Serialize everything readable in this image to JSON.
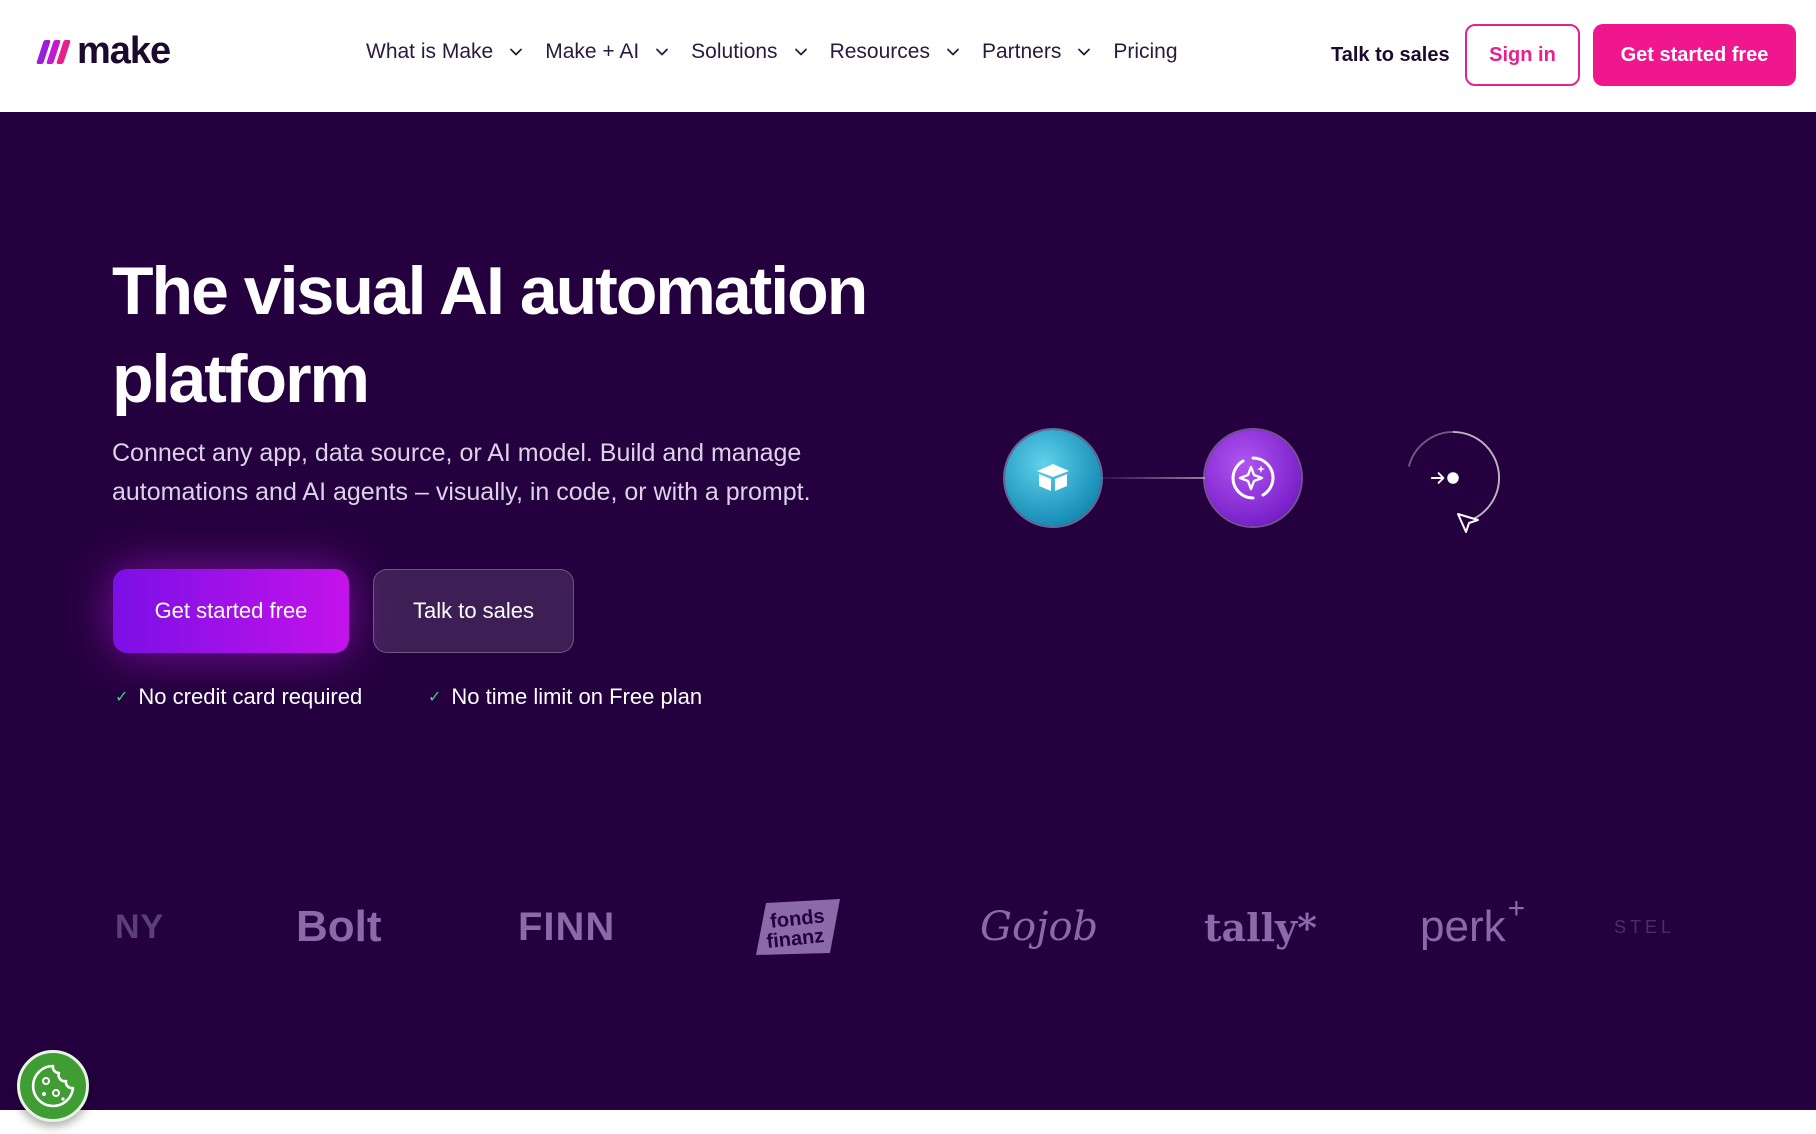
{
  "header": {
    "logo_text": "make",
    "nav": [
      {
        "label": "What is Make",
        "has_dropdown": true
      },
      {
        "label": "Make + AI",
        "has_dropdown": true
      },
      {
        "label": "Solutions",
        "has_dropdown": true
      },
      {
        "label": "Resources",
        "has_dropdown": true
      },
      {
        "label": "Partners",
        "has_dropdown": true
      },
      {
        "label": "Pricing",
        "has_dropdown": false
      }
    ],
    "talk_to_sales": "Talk to sales",
    "sign_in": "Sign in",
    "get_started": "Get started free"
  },
  "hero": {
    "title": "The visual AI automation platform",
    "subtitle": "Connect any app, data source, or AI model. Build and manage automations and AI agents – visually, in code, or with a prompt.",
    "cta_primary": "Get started free",
    "cta_secondary": "Talk to sales",
    "checks": [
      "No credit card required",
      "No time limit on Free plan"
    ]
  },
  "logos": {
    "ny": "NY",
    "bolt": "Bolt",
    "finn": "FINN",
    "fonds_1": "fonds",
    "fonds_2": "finanz",
    "gojob": "Gojob",
    "tally": "tally*",
    "perk": "perk",
    "stel": "STEL"
  },
  "icons": {
    "flow_node_1": "box-icon",
    "flow_node_2": "ai-sparkle-icon",
    "flow_node_3": "arrow-dot-icon",
    "cursor": "cursor-pointer-icon",
    "cookie": "cookie-icon"
  },
  "colors": {
    "brand_pink": "#f0168e",
    "hero_bg": "#24003e",
    "cta_gradient_start": "#7b10e6",
    "cta_gradient_end": "#c412ea",
    "check_green": "#3fd07a"
  }
}
